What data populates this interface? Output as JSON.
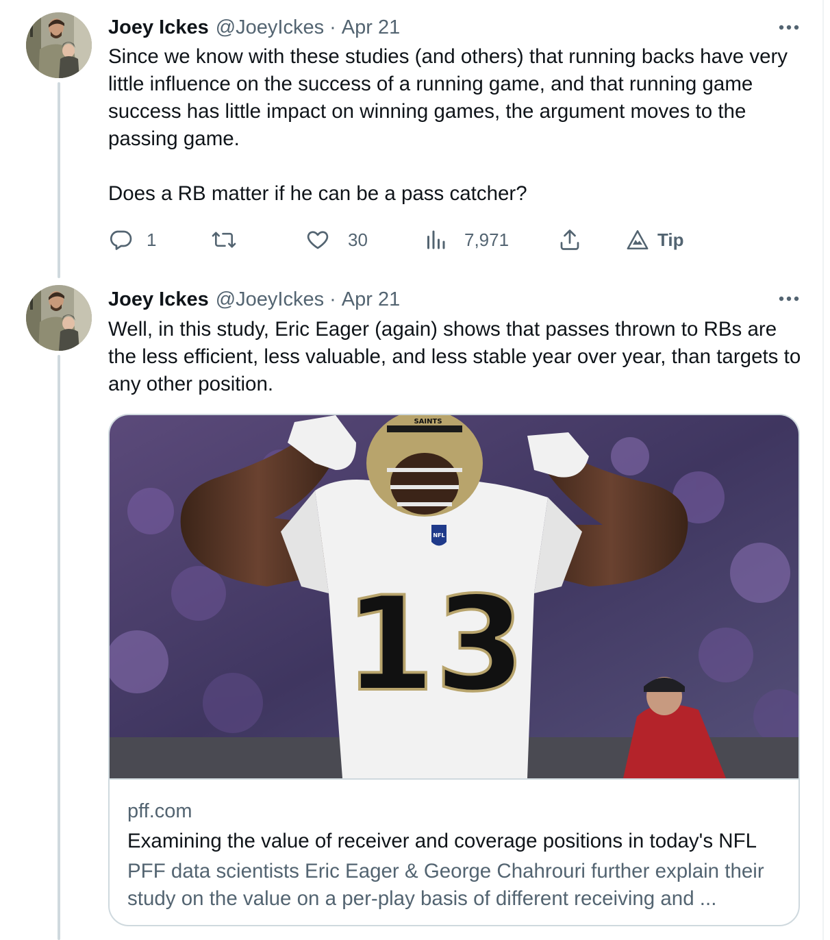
{
  "tweets": [
    {
      "author_name": "Joey Ickes",
      "handle": "@JoeyIckes",
      "separator": "·",
      "date": "Apr 21",
      "text": "Since we know with these studies (and others) that running backs have very little influence on the success of a running game, and that running game success has little impact on winning games, the argument moves to the passing game.\n\nDoes a RB matter if he can be a pass catcher?",
      "actions": {
        "replies": "1",
        "retweets": "",
        "likes": "30",
        "views": "7,971",
        "tip_label": "Tip"
      }
    },
    {
      "author_name": "Joey Ickes",
      "handle": "@JoeyIckes",
      "separator": "·",
      "date": "Apr 21",
      "text": "Well, in this study, Eric Eager (again) shows that passes thrown to RBs are the less efficient, less valuable, and less stable year over year, than targets to any other position.",
      "link_card": {
        "image_jersey_number": "13",
        "image_helmet_text": "SAINTS",
        "image_shield_text": "NFL",
        "domain": "pff.com",
        "title": "Examining the value of receiver and coverage positions in today's NFL",
        "description": "PFF data scientists Eric Eager & George Chahrouri further explain their study on the value on a per-play basis of different receiving and ..."
      }
    }
  ],
  "icons": {
    "more": "more-horizontal-icon",
    "reply": "reply-icon",
    "retweet": "retweet-icon",
    "like": "heart-icon",
    "views": "views-icon",
    "share": "share-icon",
    "tip": "tip-icon"
  },
  "colors": {
    "text_primary": "#0f1419",
    "text_secondary": "#536471",
    "border": "#cfd9de",
    "background": "#ffffff"
  }
}
